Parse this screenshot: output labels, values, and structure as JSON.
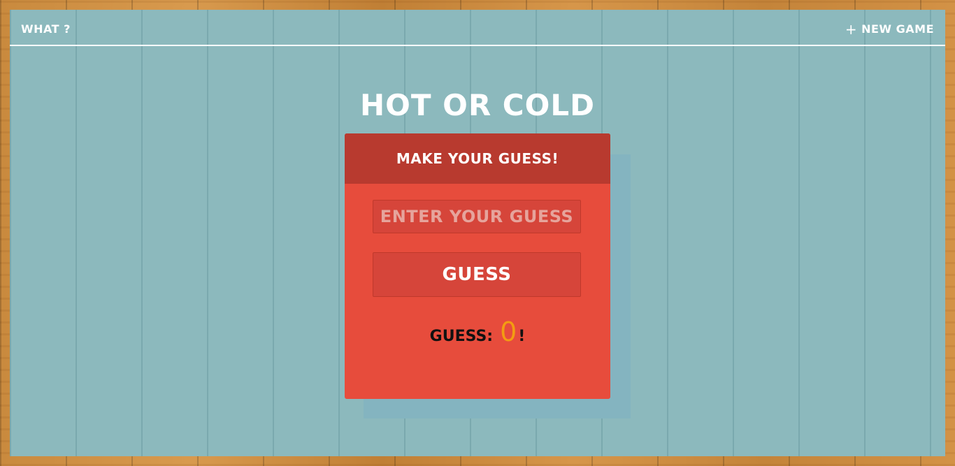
{
  "topbar": {
    "what_label": "WHAT ?",
    "new_game_icon": "+",
    "new_game_label": "NEW GAME"
  },
  "title": "HOT OR COLD",
  "card": {
    "header": "MAKE YOUR GUESS!",
    "input_placeholder": "ENTER YOUR GUESS",
    "input_value": "",
    "button_label": "GUESS",
    "count_label": "GUESS:",
    "count_value": "0",
    "count_suffix": "!"
  },
  "colors": {
    "panel": "#8cb9bd",
    "card": "#e74c3c",
    "card_header": "#b83a2f",
    "count_accent": "#f39c12"
  }
}
